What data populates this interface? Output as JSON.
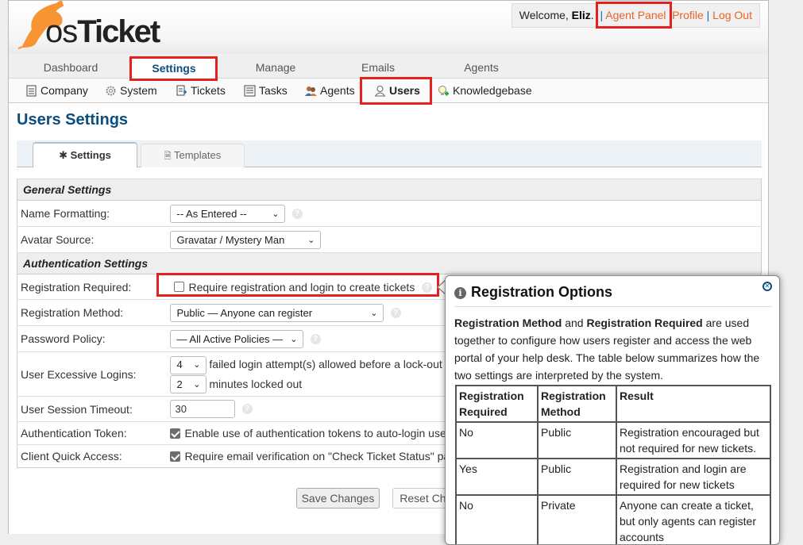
{
  "header": {
    "logo_text_os": "os",
    "logo_text_ticket": "Ticket",
    "welcome_prefix": "Welcome, ",
    "user_name": "Eliz",
    "welcome_suffix": ".",
    "links": [
      "Agent Panel",
      "Profile",
      "Log Out"
    ],
    "separator": "|"
  },
  "nav": {
    "tabs": [
      {
        "label": "Dashboard",
        "active": false
      },
      {
        "label": "Settings",
        "active": true
      },
      {
        "label": "Manage",
        "active": false
      },
      {
        "label": "Emails",
        "active": false
      },
      {
        "label": "Agents",
        "active": false
      }
    ]
  },
  "subnav": {
    "items": [
      {
        "label": "Company",
        "icon": "company-icon"
      },
      {
        "label": "System",
        "icon": "gear-icon"
      },
      {
        "label": "Tickets",
        "icon": "ticket-icon"
      },
      {
        "label": "Tasks",
        "icon": "tasks-icon"
      },
      {
        "label": "Agents",
        "icon": "agents-icon"
      },
      {
        "label": "Users",
        "icon": "user-icon",
        "active": true
      },
      {
        "label": "Knowledgebase",
        "icon": "knowledgebase-icon"
      }
    ]
  },
  "page": {
    "title": "Users Settings",
    "tabs": [
      {
        "label": "Settings",
        "icon": "asterisk-icon",
        "active": true
      },
      {
        "label": "Templates",
        "icon": "document-icon",
        "active": false
      }
    ]
  },
  "settings": {
    "general_header": "General Settings",
    "name_formatting": {
      "label": "Name Formatting:",
      "value": "-- As Entered --"
    },
    "avatar_source": {
      "label": "Avatar Source:",
      "value": "Gravatar / Mystery Man"
    },
    "auth_header": "Authentication Settings",
    "registration_required": {
      "label": "Registration Required:",
      "checkbox_label": "Require registration and login to create tickets",
      "checked": false
    },
    "registration_method": {
      "label": "Registration Method:",
      "value": "Public — Anyone can register"
    },
    "password_policy": {
      "label": "Password Policy:",
      "value": "— All Active Policies —"
    },
    "excessive_logins": {
      "label": "User Excessive Logins:",
      "attempts_value": "4",
      "attempts_text": "failed login attempt(s) allowed before a lock-out is enforced",
      "minutes_value": "2",
      "minutes_text": "minutes locked out"
    },
    "session_timeout": {
      "label": "User Session Timeout:",
      "value": "30"
    },
    "auth_token": {
      "label": "Authentication Token:",
      "checkbox_label": "Enable use of authentication tokens to auto-login users",
      "checked": true
    },
    "quick_access": {
      "label": "Client Quick Access:",
      "checkbox_label": "Require email verification on \"Check Ticket Status\" page",
      "checked": true
    }
  },
  "buttons": {
    "save": "Save Changes",
    "reset": "Reset Changes"
  },
  "popup": {
    "title": "Registration Options",
    "desc_bold1": "Registration Method",
    "desc_mid": " and ",
    "desc_bold2": "Registration Required",
    "desc_rest": " are used together to configure how users register and access the web portal of your help desk. The table below summarizes how the two settings are interpreted by the system.",
    "table": {
      "headers": [
        "Registration Required",
        "Registration Method",
        "Result"
      ],
      "rows": [
        [
          "No",
          "Public",
          "Registration encouraged but not required for new tickets."
        ],
        [
          "Yes",
          "Public",
          "Registration and login are required for new tickets"
        ],
        [
          "No",
          "Private",
          "Anyone can create a ticket, but only agents can register accounts"
        ]
      ]
    }
  }
}
